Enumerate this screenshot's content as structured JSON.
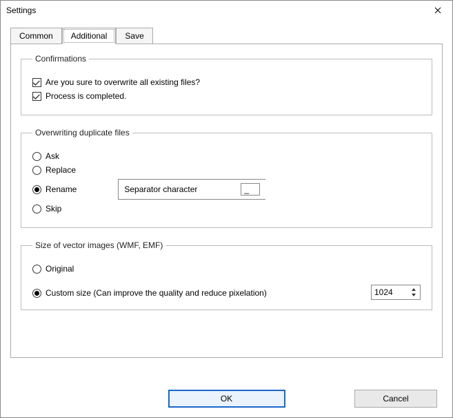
{
  "window": {
    "title": "Settings"
  },
  "tabs": {
    "common": "Common",
    "additional": "Additional",
    "save": "Save",
    "active": "additional"
  },
  "confirmations": {
    "legend": "Confirmations",
    "overwrite": {
      "label": "Are you sure to overwrite all existing files?",
      "checked": true
    },
    "completed": {
      "label": "Process is completed.",
      "checked": true
    }
  },
  "overwriting": {
    "legend": "Overwriting duplicate files",
    "ask": "Ask",
    "replace": "Replace",
    "rename": "Rename",
    "skip": "Skip",
    "selected": "rename",
    "sep_label": "Separator character",
    "sep_value": "_"
  },
  "vector": {
    "legend": "Size of vector images (WMF, EMF)",
    "original": "Original",
    "custom": "Custom size (Can improve the quality and reduce pixelation)",
    "selected": "custom",
    "value": "1024"
  },
  "buttons": {
    "ok": "OK",
    "cancel": "Cancel"
  }
}
